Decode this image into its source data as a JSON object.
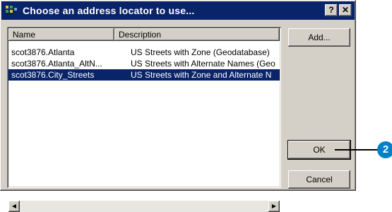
{
  "window": {
    "title": "Choose an address locator to use...",
    "help_label": "?",
    "close_label": "✕"
  },
  "list": {
    "columns": [
      "Name",
      "Description"
    ],
    "rows": [
      {
        "name": "scot3876.Atlanta",
        "description": "US Streets with Zone (Geodatabase)",
        "selected": false
      },
      {
        "name": "scot3876.Atlanta_AltN...",
        "description": "US Streets with Alternate Names (Geo",
        "selected": false
      },
      {
        "name": "scot3876.City_Streets",
        "description": "US Streets with Zone and Alternate N",
        "selected": true
      }
    ]
  },
  "buttons": {
    "add": "Add...",
    "ok": "OK",
    "cancel": "Cancel"
  },
  "callout": {
    "number": "2",
    "color": "#0080c6"
  },
  "icons": {
    "app": "address-locator-icon",
    "scroll_left": "arrow-left-icon",
    "scroll_right": "arrow-right-icon"
  }
}
